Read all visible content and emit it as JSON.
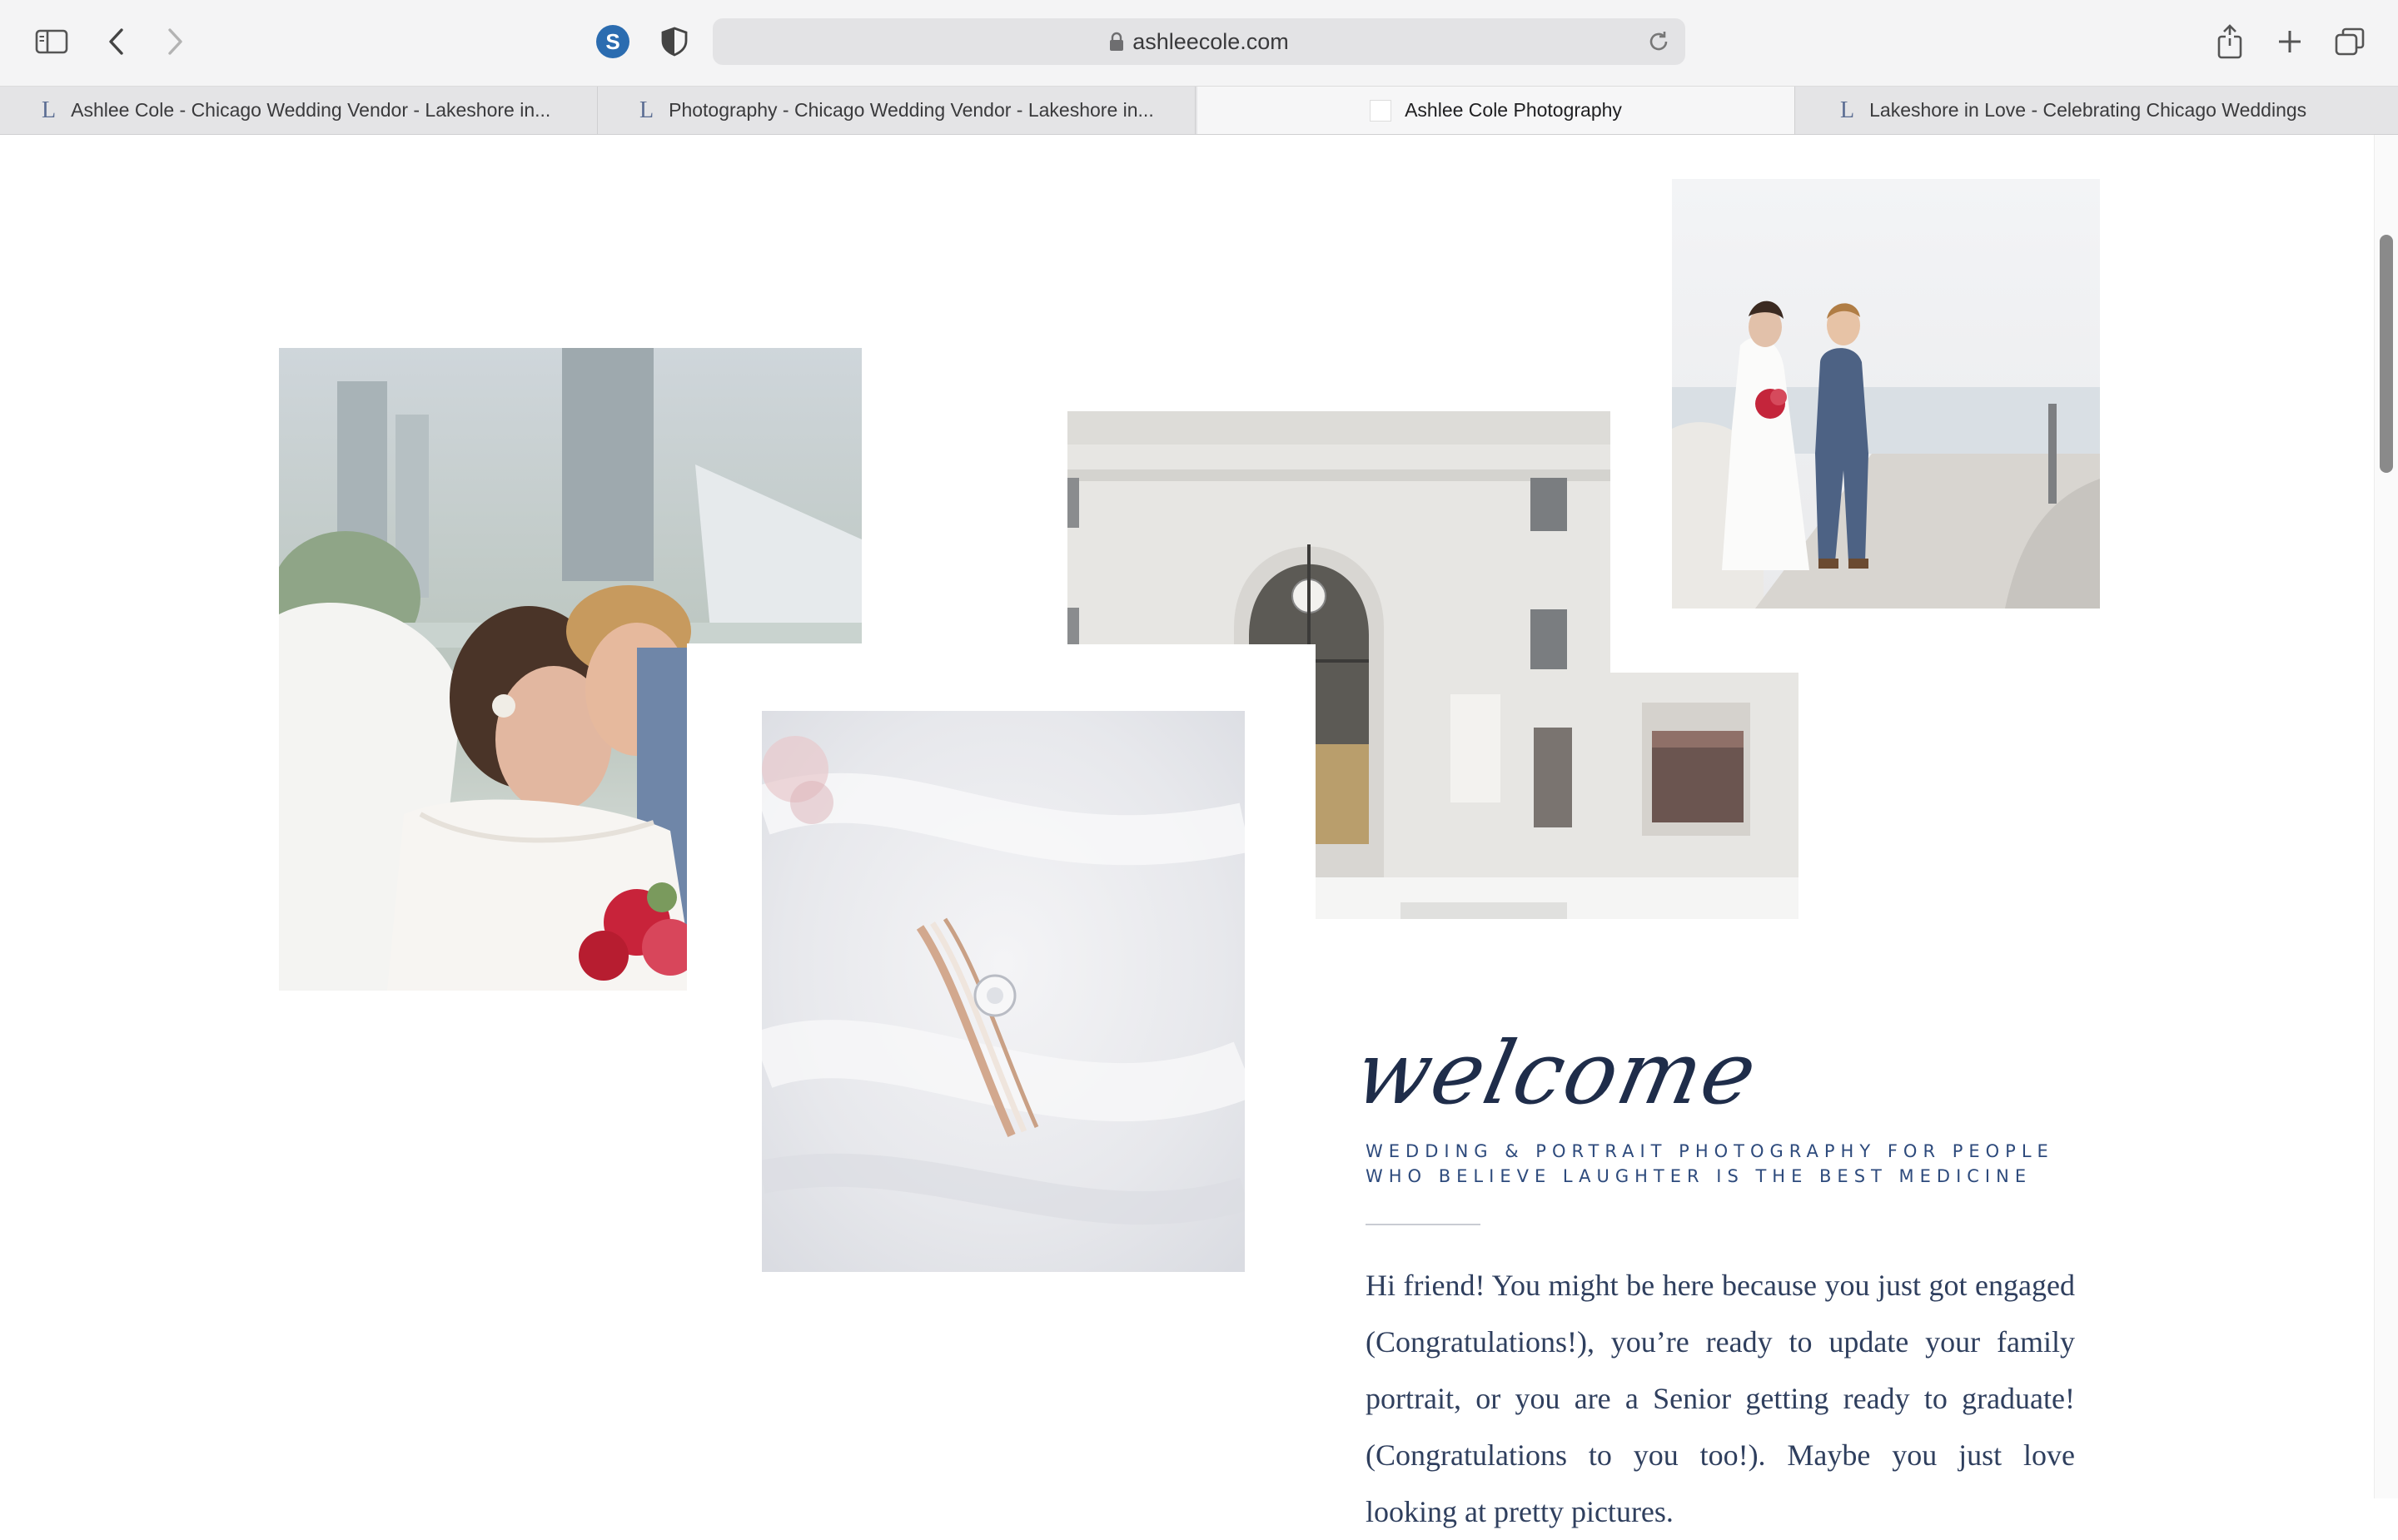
{
  "browser": {
    "url": "ashleecole.com",
    "tabs": [
      {
        "title": "Ashlee Cole - Chicago Wedding Vendor - Lakeshore in...",
        "favicon": "L"
      },
      {
        "title": "Photography - Chicago Wedding Vendor - Lakeshore in...",
        "favicon": "L"
      },
      {
        "title": "Ashlee Cole Photography",
        "favicon": ""
      },
      {
        "title": "Lakeshore in Love - Celebrating Chicago Weddings",
        "favicon": "L"
      }
    ],
    "active_tab": 2,
    "extension_letter": "S",
    "icons": [
      "sidebar-icon",
      "back-icon",
      "forward-icon",
      "extension-s-icon",
      "privacy-shield-icon",
      "lock-icon",
      "reload-icon",
      "share-icon",
      "new-tab-icon",
      "tab-overview-icon"
    ]
  },
  "page": {
    "gallery": [
      {
        "name": "couple-kiss-photo"
      },
      {
        "name": "ring-photo"
      },
      {
        "name": "building-photo"
      },
      {
        "name": "couple-walking-photo"
      }
    ],
    "welcome_heading": "welcome",
    "tagline_line1": "WEDDING & PORTRAIT PHOTOGRAPHY FOR PEOPLE",
    "tagline_line2": "WHO BELIEVE LAUGHTER IS THE BEST MEDICINE",
    "intro_text": "Hi friend! You might be here because you just got engaged (Congratulations!), you’re ready to update your family portrait, or you are a Senior getting ready to graduate! (Congratulations to you too!). Maybe you just love looking at pretty pictures."
  },
  "colors": {
    "heading": "#1f2d4a",
    "tagline": "#2d4a7c",
    "body": "#2f3f5e"
  }
}
